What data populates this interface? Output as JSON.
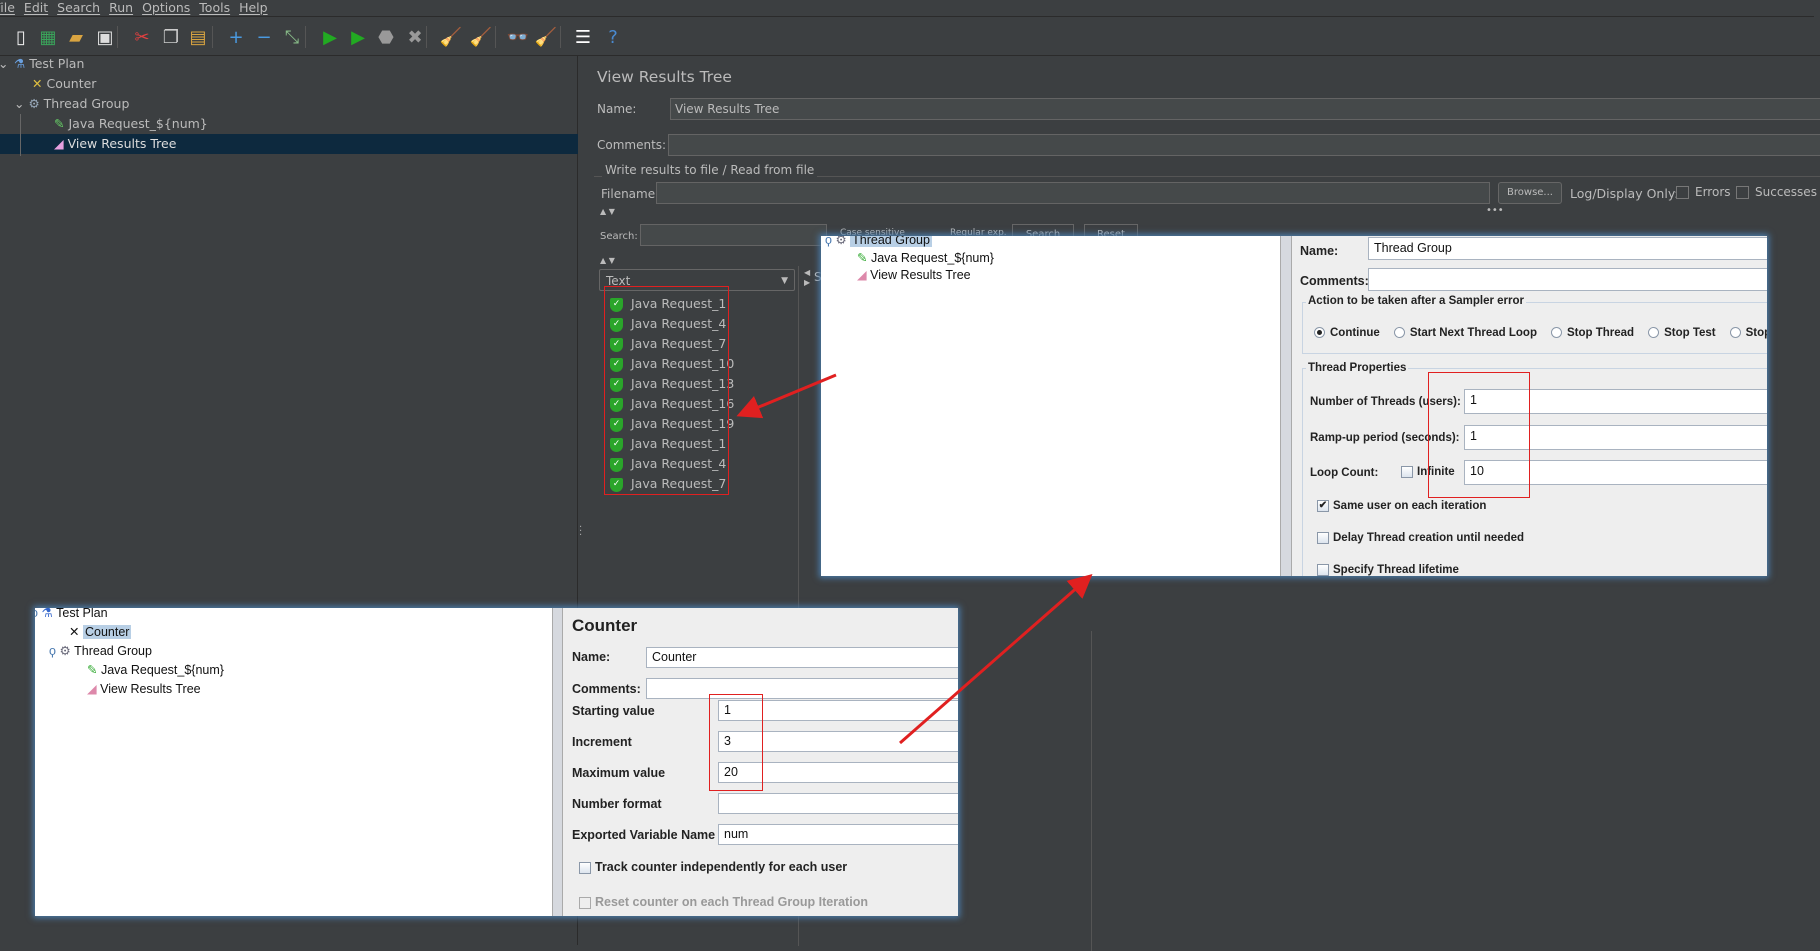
{
  "menu": [
    "File",
    "Edit",
    "Search",
    "Run",
    "Options",
    "Tools",
    "Help"
  ],
  "toolbar": [
    {
      "icon": "new-icon",
      "glyph": "▯",
      "color": "#eeeeee"
    },
    {
      "icon": "templates-icon",
      "glyph": "▦",
      "color": "#3aa35a"
    },
    {
      "icon": "open-icon",
      "glyph": "▰",
      "color": "#d9a441"
    },
    {
      "icon": "save-icon",
      "glyph": "▣",
      "color": "#dddddd"
    },
    {
      "icon": "cut-icon",
      "glyph": "✂",
      "color": "#e04040"
    },
    {
      "icon": "copy-icon",
      "glyph": "❐",
      "color": "#cccccc"
    },
    {
      "icon": "paste-icon",
      "glyph": "▤",
      "color": "#d9a441"
    },
    {
      "icon": "expand-icon",
      "glyph": "+",
      "color": "#4a9ae0"
    },
    {
      "icon": "collapse-icon",
      "glyph": "−",
      "color": "#4a9ae0"
    },
    {
      "icon": "toggle-icon",
      "glyph": "⤡",
      "color": "#88bb88"
    },
    {
      "icon": "start-icon",
      "glyph": "▶",
      "color": "#22aa22"
    },
    {
      "icon": "start-no-pauses-icon",
      "glyph": "▶",
      "color": "#22aa22"
    },
    {
      "icon": "stop-icon",
      "glyph": "⬣",
      "color": "#999999"
    },
    {
      "icon": "shutdown-icon",
      "glyph": "✖",
      "color": "#999999"
    },
    {
      "icon": "clear-icon",
      "glyph": "🧹",
      "color": "#b08050"
    },
    {
      "icon": "clear-all-icon",
      "glyph": "🧹",
      "color": "#b08050"
    },
    {
      "icon": "search-icon",
      "glyph": "👓",
      "color": "#dddddd"
    },
    {
      "icon": "reset-search-icon",
      "glyph": "🧹",
      "color": "#e8c020"
    },
    {
      "icon": "function-helper-icon",
      "glyph": "☰",
      "color": "#ffffff"
    },
    {
      "icon": "help-icon",
      "glyph": "?",
      "color": "#4a8ad0"
    }
  ],
  "tree": [
    {
      "label": "Test Plan",
      "icon": "flask-icon"
    },
    {
      "label": "Counter",
      "icon": "tools-icon"
    },
    {
      "label": "Thread Group",
      "icon": "gear-icon"
    },
    {
      "label": "Java Request_${num}",
      "icon": "pipette-icon"
    },
    {
      "label": "View Results Tree",
      "icon": "graph-icon",
      "selected": true
    }
  ],
  "vrt": {
    "title": "View Results Tree",
    "name_label": "Name:",
    "name_value": "View Results Tree",
    "comments_label": "Comments:",
    "comments_value": "",
    "file_group": "Write results to file / Read from file",
    "filename_label": "Filename",
    "filename_value": "",
    "browse": "Browse...",
    "log_display": "Log/Display Only:",
    "errors": "Errors",
    "successes": "Successes",
    "search_label": "Search:",
    "search_value": "",
    "case_sensitive": "Case sensitive",
    "regexp": "Regular exp.",
    "search_btn": "Search",
    "reset_btn": "Reset",
    "renderer": "Text",
    "results": [
      "Java Request_1",
      "Java Request_4",
      "Java Request_7",
      "Java Request_10",
      "Java Request_13",
      "Java Request_16",
      "Java Request_19",
      "Java Request_1",
      "Java Request_4",
      "Java Request_7"
    ],
    "sampler_tab": "S"
  },
  "thread_group_shot": {
    "tree": [
      "Thread Group",
      "Java Request_${num}",
      "View Results Tree"
    ],
    "name_label": "Name:",
    "name_value": "Thread Group",
    "comments_label": "Comments:",
    "action_group": "Action to be taken after a Sampler error",
    "actions": [
      {
        "label": "Continue",
        "selected": true
      },
      {
        "label": "Start Next Thread Loop"
      },
      {
        "label": "Stop Thread"
      },
      {
        "label": "Stop Test"
      },
      {
        "label": "Stop T"
      }
    ],
    "props_group": "Thread Properties",
    "threads_label": "Number of Threads (users):",
    "threads_value": "1",
    "rampup_label": "Ramp-up period (seconds):",
    "rampup_value": "1",
    "loop_label": "Loop Count:",
    "infinite": "Infinite",
    "loop_value": "10",
    "same_user": "Same user on each iteration",
    "same_user_checked": true,
    "delay": "Delay Thread creation until needed",
    "lifetime": "Specify Thread lifetime"
  },
  "counter_shot": {
    "tree": [
      "Test Plan",
      "Counter",
      "Thread Group",
      "Java Request_${num}",
      "View Results Tree"
    ],
    "title": "Counter",
    "name_label": "Name:",
    "name_value": "Counter",
    "comments_label": "Comments:",
    "start_label": "Starting value",
    "start_value": "1",
    "incr_label": "Increment",
    "incr_value": "3",
    "max_label": "Maximum value",
    "max_value": "20",
    "format_label": "Number format",
    "format_value": "",
    "var_label": "Exported Variable Name",
    "var_value": "num",
    "track": "Track counter independently for each user",
    "reset": "Reset counter on each Thread Group Iteration"
  },
  "colors": {
    "annotation": "#e02020",
    "selection": "#0d293e",
    "dark_bg": "#3c3f41"
  }
}
